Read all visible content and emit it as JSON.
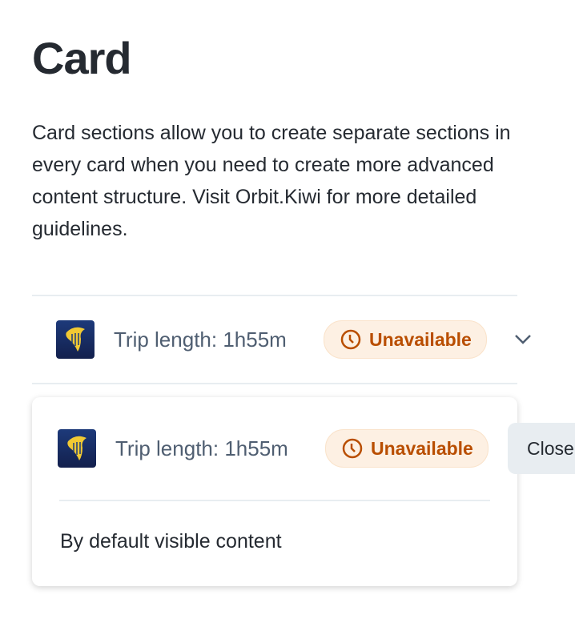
{
  "title": "Card",
  "description": "Card sections allow you to create separate sections in every card when you need to create more advanced content structure. Visit Orbit.Kiwi for more detailed guidelines.",
  "section1": {
    "trip": "Trip length: 1h55m",
    "badge": "Unavailable",
    "icon": "chevron-down-icon"
  },
  "section2": {
    "trip": "Trip length: 1h55m",
    "badge": "Unavailable",
    "close_label": "Close",
    "content": "By default visible content"
  },
  "colors": {
    "badge_text": "#b94e00",
    "badge_bg": "#fdf0e3",
    "logo_bg": "#1d3a7a",
    "logo_harp": "#f1c933"
  }
}
